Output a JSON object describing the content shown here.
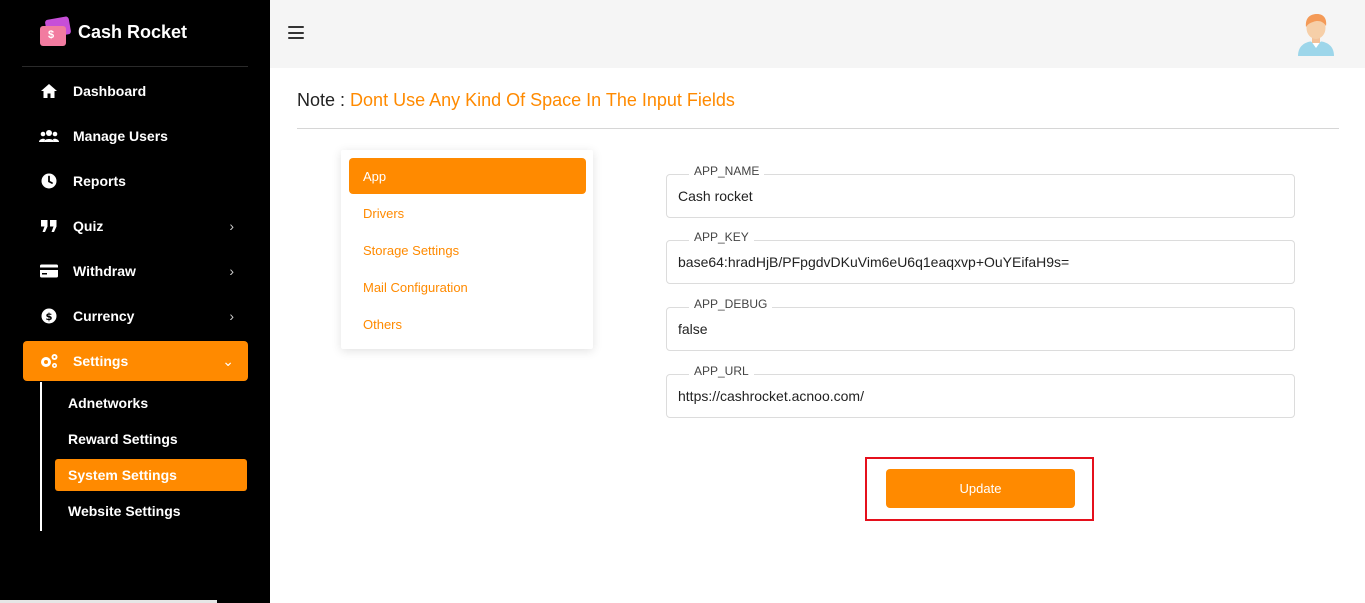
{
  "brand": {
    "name": "Cash Rocket",
    "logo_glyph": "$"
  },
  "sidebar": {
    "items": [
      {
        "label": "Dashboard",
        "icon": "home-icon"
      },
      {
        "label": "Manage Users",
        "icon": "users-icon"
      },
      {
        "label": "Reports",
        "icon": "clock-icon"
      },
      {
        "label": "Quiz",
        "icon": "quote-icon",
        "chevron": "›"
      },
      {
        "label": "Withdraw",
        "icon": "credit-card-icon",
        "chevron": "›"
      },
      {
        "label": "Currency",
        "icon": "dollar-circle-icon",
        "chevron": "›"
      },
      {
        "label": "Settings",
        "icon": "cogs-icon",
        "chevron": "⌄",
        "active": true
      }
    ],
    "submenu": [
      {
        "label": "Adnetworks"
      },
      {
        "label": "Reward Settings"
      },
      {
        "label": "System Settings",
        "active": true
      },
      {
        "label": "Website Settings"
      }
    ]
  },
  "note": {
    "prefix": "Note :",
    "text": "Dont Use Any Kind Of Space In The Input Fields"
  },
  "tabs": [
    {
      "label": "App",
      "active": true
    },
    {
      "label": "Drivers"
    },
    {
      "label": "Storage Settings"
    },
    {
      "label": "Mail Configuration"
    },
    {
      "label": "Others"
    }
  ],
  "fields": [
    {
      "label": "APP_NAME",
      "value": "Cash rocket"
    },
    {
      "label": "APP_KEY",
      "value": "base64:hradHjB/PFpgdvDKuVim6eU6q1eaqxvp+OuYEifaH9s="
    },
    {
      "label": "APP_DEBUG",
      "value": "false"
    },
    {
      "label": "APP_URL",
      "value": "https://cashrocket.acnoo.com/"
    }
  ],
  "update_button": {
    "label": "Update"
  },
  "colors": {
    "accent": "#ff8a00",
    "sidebar_bg": "#000000",
    "highlight": "#e5101c"
  }
}
